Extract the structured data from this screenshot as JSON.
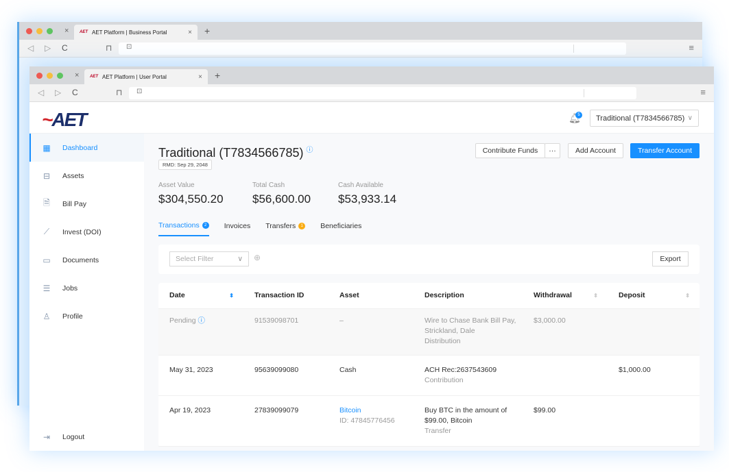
{
  "back_window": {
    "tab_title": "AET Platform | Business Portal",
    "favicon": "AET"
  },
  "front_window": {
    "tab_title": "AET Platform | User Portal",
    "favicon": "AET"
  },
  "browser_icons": {
    "close": "×",
    "new_tab": "+",
    "back": "◁",
    "forward": "▷",
    "reload": "C",
    "bookmark": "⊓",
    "lock": "⊡",
    "menu": "≡"
  },
  "header": {
    "logo": "AET",
    "notification_count": "5",
    "account_selector": "Traditional (T7834566785)"
  },
  "sidebar": {
    "items": [
      {
        "label": "Dashboard",
        "icon": "calendar-icon",
        "active": true
      },
      {
        "label": "Assets",
        "icon": "briefcase-icon"
      },
      {
        "label": "Bill Pay",
        "icon": "bill-icon"
      },
      {
        "label": "Invest (DOI)",
        "icon": "chart-icon"
      },
      {
        "label": "Documents",
        "icon": "folder-icon"
      },
      {
        "label": "Jobs",
        "icon": "checklist-icon"
      },
      {
        "label": "Profile",
        "icon": "user-icon"
      }
    ],
    "logout": "Logout"
  },
  "account": {
    "title": "Traditional (T7834566785)",
    "rmd": "RMD: Sep 29, 2048",
    "buttons": {
      "contribute": "Contribute Funds",
      "more": "···",
      "add_account": "Add Account",
      "transfer_account": "Transfer Account"
    },
    "stats": [
      {
        "label": "Asset Value",
        "value": "$304,550.20"
      },
      {
        "label": "Total Cash",
        "value": "$56,600.00"
      },
      {
        "label": "Cash Available",
        "value": "$53,933.14"
      }
    ]
  },
  "tabs": [
    {
      "label": "Transactions",
      "badge": "2",
      "badge_color": "#1890ff",
      "active": true
    },
    {
      "label": "Invoices"
    },
    {
      "label": "Transfers",
      "badge": "1",
      "badge_color": "#faad14"
    },
    {
      "label": "Beneficiaries"
    }
  ],
  "filter": {
    "placeholder": "Select Filter",
    "export": "Export"
  },
  "table": {
    "headers": [
      "Date",
      "Transaction ID",
      "Asset",
      "Description",
      "Withdrawal",
      "Deposit"
    ],
    "rows": [
      {
        "date": "Pending",
        "txn_id": "91539098701",
        "asset": "–",
        "asset_sub": "",
        "desc": "Wire to Chase Bank Bill Pay, Strickland, Dale",
        "desc_sub": "Distribution",
        "withdrawal": "$3,000.00",
        "deposit": ""
      },
      {
        "date": "May 31, 2023",
        "txn_id": "95639099080",
        "asset": "Cash",
        "asset_sub": "",
        "desc": "ACH Rec:2637543609",
        "desc_sub": "Contribution",
        "withdrawal": "",
        "deposit": "$1,000.00"
      },
      {
        "date": "Apr 19, 2023",
        "txn_id": "27839099079",
        "asset": "Bitcoin",
        "asset_sub": "ID: 47845776456",
        "desc": "Buy BTC in the amount of $99.00, Bitcoin",
        "desc_sub": "Transfer",
        "withdrawal": "$99.00",
        "deposit": ""
      }
    ]
  }
}
